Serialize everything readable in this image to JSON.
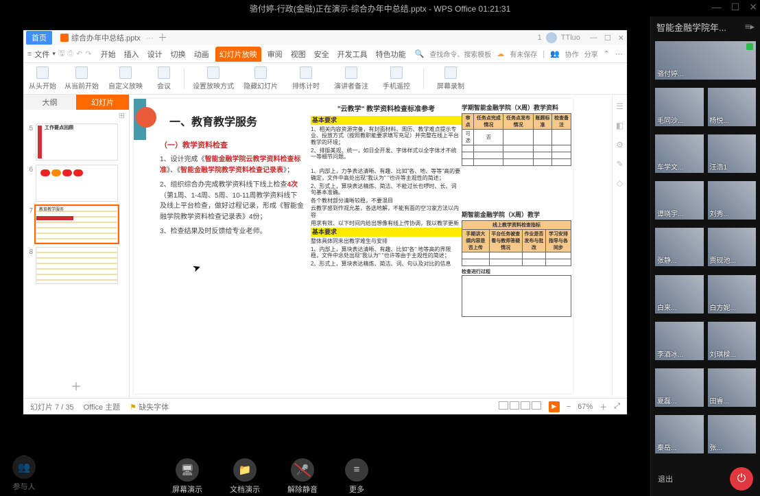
{
  "meeting": {
    "title_bar": "骆付婷-行政(金融)正在演示-综合办年中总结.pptx - WPS Office 01:21:31",
    "room_name": "智能金融学院年...",
    "bottom_buttons": {
      "participants": "参与人",
      "share_screen": "屏幕演示",
      "share_doc": "文档演示",
      "mute": "解除静音",
      "more": "更多",
      "exit": "退出"
    }
  },
  "participants": [
    {
      "name": "骆付婷...",
      "presenter": true,
      "mic_on": true
    },
    {
      "name": "毛同沙..."
    },
    {
      "name": "杨悦..."
    },
    {
      "name": "车学文..."
    },
    {
      "name": "汪浩1"
    },
    {
      "name": "谭晓宇..."
    },
    {
      "name": "刘秀..."
    },
    {
      "name": "张静..."
    },
    {
      "name": "贾砚池..."
    },
    {
      "name": "白来..."
    },
    {
      "name": "白方妮..."
    },
    {
      "name": "李酒冰..."
    },
    {
      "name": "刘琪樑..."
    },
    {
      "name": "夏磊..."
    },
    {
      "name": "田睿..."
    },
    {
      "name": "秦岳..."
    },
    {
      "name": "张..."
    }
  ],
  "wps": {
    "home_btn": "首页",
    "tab_name": "综合办年中总结.pptx",
    "user_name": "TTluo",
    "menu": {
      "file": "文件",
      "tabs": [
        "开始",
        "插入",
        "设计",
        "切换",
        "动画",
        "幻灯片放映",
        "审阅",
        "视图",
        "安全",
        "开发工具",
        "特色功能"
      ],
      "active_index": 5,
      "search_placeholder": "查找命令、搜索模板",
      "cloud_label": "有未保存",
      "coop": "协作",
      "share": "分享"
    },
    "toolbar": {
      "from_start": "从头开始",
      "from_current": "从当前开始",
      "custom_show": "自定义放映",
      "meeting": "会议",
      "setup_show": "设置放映方式",
      "hide_slide": "隐藏幻灯片",
      "rehearse": "排练计时",
      "presenter_notes": "演讲者备注",
      "phone_remote": "手机遥控",
      "screen_record": "屏幕录制"
    },
    "leftpanel": {
      "tab_outline": "大纲",
      "tab_slides": "幻灯片"
    },
    "thumbs": [
      {
        "num": "5",
        "caption": "工作要点回顾"
      },
      {
        "num": "6",
        "caption": ""
      },
      {
        "num": "7",
        "caption": "教育教学服务"
      },
      {
        "num": "8",
        "caption": ""
      }
    ],
    "statusbar": {
      "slide_counter": "幻灯片 7 / 35",
      "theme": "Office 主题",
      "missing_font": "缺失字体",
      "zoom": "67%"
    }
  },
  "slide": {
    "title": "一、教育教学服务",
    "section_heading": "（一）教学资料检查",
    "para1_a": "1、设计完成《",
    "para1_b": "智能金融学院云教学资料检查标准",
    "para1_c": "》、《",
    "para1_d": "智能金融学院教学资料检查记录表",
    "para1_e": "》；",
    "para2_a": "2、组织综合办完成教学资料线下线上检查",
    "para2_b": "4次",
    "para2_c": "（第1周、1-4周、5周、10-11周教学资料线下及线上平台检查，做好过程记录，形成《智能金融学院教学资料检查记录表》4份；",
    "para3": "3、检查结果及时反馈给专业老师。",
    "doc_r_header1": "\"云教学\" 教学资料检查标准参考",
    "basic_req_label": "基本要求",
    "doc_r_line1": "1、相关内容资源完备，有封面材料、周历、教学难点提示专业、投放方式（按照教职能要求填写充足）并完整在线上平台教学的环境；",
    "doc_r_line2": "2、排版美观、统一，如日全开发、字体样式以全字体才不统一等细节问题。",
    "doc_r_sub1": "1、内部上，力争表达清晰、有趣、比如\"各、地、等等\"高的要确定，文件中高处出现\"我认为\" \"也许等主观性的简述；",
    "doc_r_sub2": "2、形式上，算块表达精炼、简洁、不能过长也啰时、长、词句基本准确。",
    "doc_r_sub3": "各个教材部分清晰较稳，不要混目",
    "doc_r_sub4": "云教学感到作观允差，各选地解，不能有面的空习家方法以内容",
    "doc_r_sub5": "用求有效、以下时间内给出想像有线上传协调，我以教学更新",
    "doc_r_b1": "整体具体同未出教学难生与安排",
    "doc_r_b2": "1、内部上，算块表达清晰、有趣、比如\"各\" 地等高的界限稳，文件中念处出现\"我认为\" \"也许等由于主观性的简述；",
    "doc_r_b3": "2、形式上，算块表达精炼、简洁、词、句认及对比的信息",
    "table_top_title": "学期智能金融学院（X周）教学资料",
    "table_top_headers": [
      "审点",
      "任务点完成情况",
      "任务点发布情况",
      "账顾标准",
      "检查备注"
    ],
    "table_top_row": [
      "可选",
      "否",
      "",
      "",
      ""
    ],
    "table_mid_title": "期智能金融学院（X周）教学",
    "table_mid_header_group": "线上教学资料检查指标",
    "table_mid_headers": [
      "手期讲大纲内容是否上传",
      "平台任务被查看与教师答疑情况",
      "作业是否发布与批改",
      "学习安排指导与各同步"
    ],
    "doc_r_bottom_label": "检查进行过程"
  }
}
